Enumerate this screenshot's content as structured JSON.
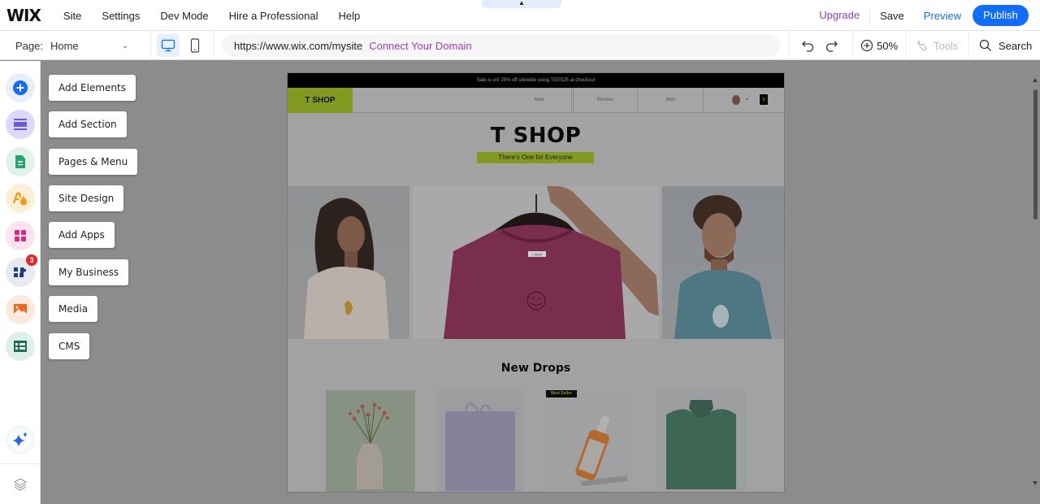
{
  "topbar": {
    "logo": "WIX",
    "menu": [
      "Site",
      "Settings",
      "Dev Mode",
      "Hire a Professional",
      "Help"
    ],
    "collapse_icon": "chevron-up",
    "upgrade": "Upgrade",
    "save": "Save",
    "preview": "Preview",
    "publish": "Publish"
  },
  "toolbar": {
    "page_label": "Page:",
    "page_value": "Home",
    "url": "https://www.wix.com/mysite",
    "connect_domain": "Connect Your Domain",
    "zoom": "50%",
    "tools": "Tools",
    "search": "Search"
  },
  "sidebar": {
    "items": [
      {
        "label": "Add Elements",
        "icon": "plus-circle",
        "color": "#116dff",
        "bg": "#e8f0fd"
      },
      {
        "label": "Add Section",
        "icon": "section",
        "color": "#6b5bdb",
        "bg": "#ddd7fb"
      },
      {
        "label": "Pages & Menu",
        "icon": "page",
        "color": "#24a36b",
        "bg": "#e0f2ea"
      },
      {
        "label": "Site Design",
        "icon": "design",
        "color": "#f39a12",
        "bg": "#fdeed7"
      },
      {
        "label": "Add Apps",
        "icon": "apps-grid",
        "color": "#e2257c",
        "bg": "#fce4ef"
      },
      {
        "label": "My Business",
        "icon": "business",
        "color": "#1d3b8c",
        "bg": "#e7eaf3",
        "badge": "3"
      },
      {
        "label": "Media",
        "icon": "image",
        "color": "#f3661b",
        "bg": "#fde8de"
      },
      {
        "label": "CMS",
        "icon": "table",
        "color": "#16754e",
        "bg": "#dff0e8"
      }
    ],
    "ai_icon": "sparkle",
    "layers_icon": "layers"
  },
  "site": {
    "promo": "Sale is on! 25% off sitewide using TEES25 at checkout",
    "brand": "T SHOP",
    "nav": [
      "New",
      "Women",
      "Men"
    ],
    "cart_count": "0",
    "hero_title": "T SHOP",
    "tagline": "There's One for Everyone",
    "shirt_tag": "T SHOP",
    "drops_title": "New Drops",
    "best_seller": "Best Seller",
    "products": [
      "Flower Vase",
      "Tote Bag",
      "Serum Bottle",
      "Knit Sweater"
    ]
  },
  "colors": {
    "accent": "#116dff",
    "upgrade": "#9b3fc7",
    "brand_green": "#a5c429"
  }
}
